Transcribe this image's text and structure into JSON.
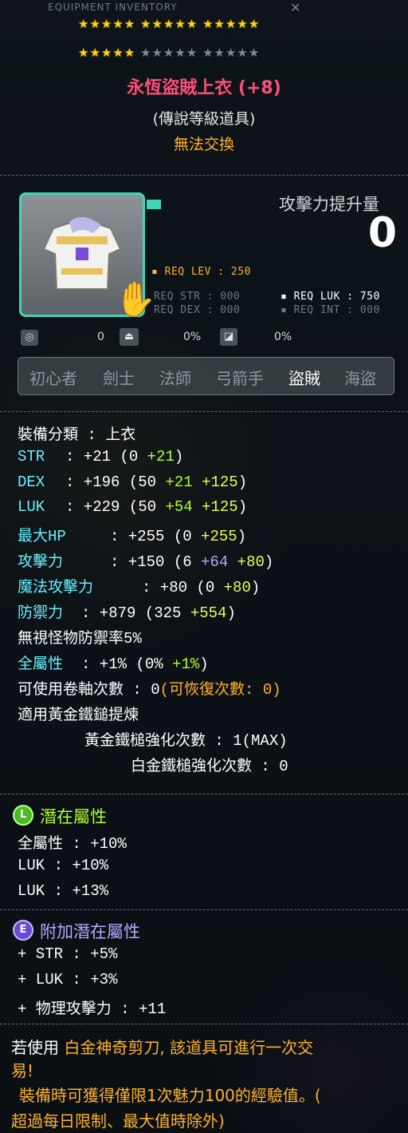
{
  "window_title": "EQUIPMENT INVENTORY",
  "stars": {
    "row1_on": 15,
    "row2_on": 5,
    "row2_off": 10
  },
  "item": {
    "name": "永恆盜賊上衣 (+8)",
    "grade": "(傳說等級道具)",
    "trade": "無法交換",
    "atk_increase_label": "攻擊力提升量",
    "atk_increase_value": "0"
  },
  "requirements": {
    "lev": "REQ LEV : 250",
    "str": "REQ STR : 000",
    "luk": "REQ LUK : 750",
    "dex": "REQ DEX : 000",
    "int": "REQ INT : 000"
  },
  "icon_row": {
    "val1": "0",
    "val2": "0%",
    "val3": "0%"
  },
  "jobs": [
    "初心者",
    "劍士",
    "法師",
    "弓箭手",
    "盜賊",
    "海盜"
  ],
  "active_job_index": 4,
  "stats": {
    "category": "裝備分類 : 上衣",
    "str_label": "STR",
    "str_total": ": +21",
    "str_open": "(0",
    "str_g": "+21",
    "str_close": ")",
    "dex_label": "DEX",
    "dex_total": ": +196",
    "dex_open": "(50",
    "dex_g": "+21",
    "dex_y": "+125",
    "dex_close": ")",
    "luk_label": "LUK",
    "luk_total": ": +229",
    "luk_open": "(50",
    "luk_g": "+54",
    "luk_y": "+125",
    "luk_close": ")",
    "hp_label": "最大HP",
    "hp_total": ": +255",
    "hp_open": "(0",
    "hp_y": "+255",
    "hp_close": ")",
    "atk_label": "攻擊力",
    "atk_total": ": +150",
    "atk_open": "(6",
    "atk_p": "+64",
    "atk_y": "+80",
    "atk_close": ")",
    "matk_label": "魔法攻擊力",
    "matk_total": ": +80",
    "matk_open": "(0",
    "matk_y": "+80",
    "matk_close": ")",
    "def_label": "防禦力",
    "def_total": ": +879",
    "def_open": "(325",
    "def_y": "+554",
    "def_close": ")",
    "ignore_def": "無視怪物防禦率5%",
    "all_label": "全屬性",
    "all_total": ": +1%",
    "all_open": "(0%",
    "all_g": "+1%",
    "all_close": ")",
    "scroll": "可使用卷軸次數 : 0",
    "scroll_recover": "(可恢復次數: 0)",
    "hammer": "適用黃金鐵鎚提煉",
    "gold_hammer": "黃金鐵槌強化次數 : 1(MAX)",
    "plat_hammer": "白金鐵槌強化次數 : 0"
  },
  "potential": {
    "badge": "L",
    "title": "潛在屬性",
    "lines": [
      "全屬性 : +10%",
      "LUK : +10%",
      "LUK : +13%"
    ]
  },
  "bonus_potential": {
    "badge": "E",
    "title": "附加潛在屬性",
    "lines": [
      "+ STR : +5%",
      "+ LUK : +3%",
      "+ 物理攻擊力 : +11"
    ]
  },
  "footer": {
    "line1_a": "若使用",
    "line1_b": "白金神奇剪刀, 該道具可進行一次交",
    "line2": "易!",
    "line3": "裝備時可獲得僅限1次魅力100的經驗值。(",
    "line4": "超過每日限制、最大值時除外)"
  },
  "colors": {
    "title": "#ff4f7a",
    "cyan": "#66f0ff",
    "green": "#b3ff2a",
    "orange": "#ffb22a",
    "purple": "#b9a6ff"
  }
}
